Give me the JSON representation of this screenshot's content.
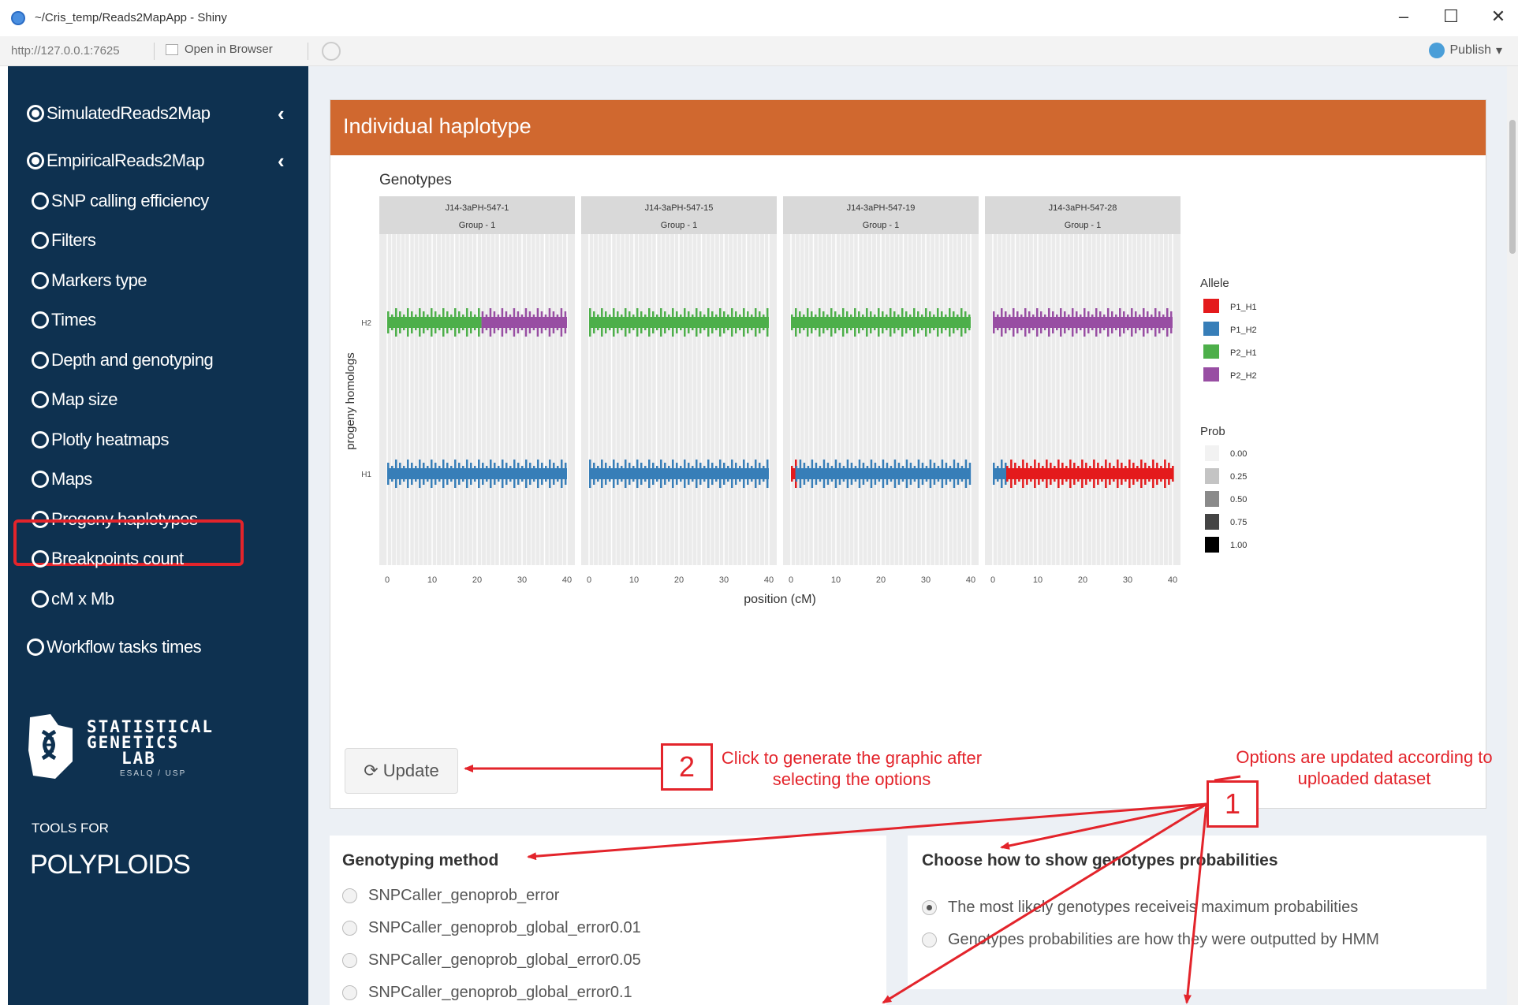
{
  "window": {
    "title": "~/Cris_temp/Reads2MapApp - Shiny",
    "controls": {
      "minimize": "–",
      "maximize": "☐",
      "close": "✕"
    }
  },
  "addressbar": {
    "url": "http://127.0.0.1:7625",
    "open_in_browser": "Open in Browser",
    "publish": "Publish"
  },
  "sidebar": {
    "items": [
      {
        "label": "SimulatedReads2Map",
        "selected": true,
        "expandable": true
      },
      {
        "label": "EmpiricalReads2Map",
        "selected": true,
        "expandable": true
      },
      {
        "label": "SNP calling efficiency"
      },
      {
        "label": "Filters"
      },
      {
        "label": "Markers type"
      },
      {
        "label": "Times"
      },
      {
        "label": "Depth and genotyping"
      },
      {
        "label": "Map size"
      },
      {
        "label": "Plotly heatmaps"
      },
      {
        "label": "Maps"
      },
      {
        "label": "Progeny haplotypes",
        "highlighted": true
      },
      {
        "label": "Breakpoints count"
      },
      {
        "label": "cM x Mb"
      },
      {
        "label": "Workflow tasks times"
      }
    ],
    "logo_sgl": {
      "lines": [
        "STATISTICAL",
        "GENETICS",
        "LAB"
      ],
      "sub": "ESALQ / USP"
    },
    "logo_tools": {
      "small": "TOOLS FOR",
      "big": "POLYPLOIDS"
    }
  },
  "main": {
    "box_title": "Individual haplotype",
    "update_button": "Update",
    "genotyping": {
      "title": "Genotyping method",
      "options": [
        "SNPCaller_genoprob_error",
        "SNPCaller_genoprob_global_error0.01",
        "SNPCaller_genoprob_global_error0.05",
        "SNPCaller_genoprob_global_error0.1"
      ]
    },
    "probabilities": {
      "title": "Choose how to show genotypes probabilities",
      "options": [
        {
          "label": "The most likely genotypes receiveis maximum probabilities",
          "selected": true
        },
        {
          "label": "Genotypes probabilities are how they were outputted by HMM",
          "selected": false
        }
      ]
    }
  },
  "annotations": {
    "num1": "1",
    "num2": "2",
    "text_update": "Click to generate the graphic after selecting the options",
    "text_options": "Options are updated according to uploaded dataset"
  },
  "colors": {
    "sidebar": "#0e3150",
    "box_header": "#d0682f",
    "annotation": "#e3242b",
    "P1_H1": "#e41a1c",
    "P1_H2": "#377eb8",
    "P2_H1": "#4daf4a",
    "P2_H2": "#984ea3"
  },
  "chart_data": {
    "type": "haplotype",
    "title": "Genotypes",
    "xlabel": "position (cM)",
    "ylabel": "progeny homologs",
    "xlim": [
      0,
      40
    ],
    "xticks": [
      0,
      10,
      20,
      30,
      40
    ],
    "homologs": [
      "H2",
      "H1"
    ],
    "panels": [
      {
        "individual": "J14-3aPH-547-1",
        "group": "Group - 1",
        "H2": [
          {
            "from": 0,
            "to": 21,
            "allele": "P2_H1"
          },
          {
            "from": 21,
            "to": 40,
            "allele": "P2_H2"
          }
        ],
        "H1": [
          {
            "from": 0,
            "to": 40,
            "allele": "P1_H2"
          }
        ]
      },
      {
        "individual": "J14-3aPH-547-15",
        "group": "Group - 1",
        "H2": [
          {
            "from": 0,
            "to": 40,
            "allele": "P2_H1"
          }
        ],
        "H1": [
          {
            "from": 0,
            "to": 40,
            "allele": "P1_H2"
          }
        ]
      },
      {
        "individual": "J14-3aPH-547-19",
        "group": "Group - 1",
        "H2": [
          {
            "from": 0,
            "to": 40,
            "allele": "P2_H1"
          }
        ],
        "H1": [
          {
            "from": 0,
            "to": 1,
            "allele": "P1_H1"
          },
          {
            "from": 1,
            "to": 40,
            "allele": "P1_H2"
          }
        ]
      },
      {
        "individual": "J14-3aPH-547-28",
        "group": "Group - 1",
        "H2": [
          {
            "from": 0,
            "to": 40,
            "allele": "P2_H2"
          }
        ],
        "H1": [
          {
            "from": 0,
            "to": 3,
            "allele": "P1_H2"
          },
          {
            "from": 3,
            "to": 40,
            "allele": "P1_H1"
          }
        ]
      }
    ],
    "legend_allele": {
      "title": "Allele",
      "entries": [
        "P1_H1",
        "P1_H2",
        "P2_H1",
        "P2_H2"
      ]
    },
    "legend_prob": {
      "title": "Prob",
      "entries": [
        "0.00",
        "0.25",
        "0.50",
        "0.75",
        "1.00"
      ]
    }
  }
}
